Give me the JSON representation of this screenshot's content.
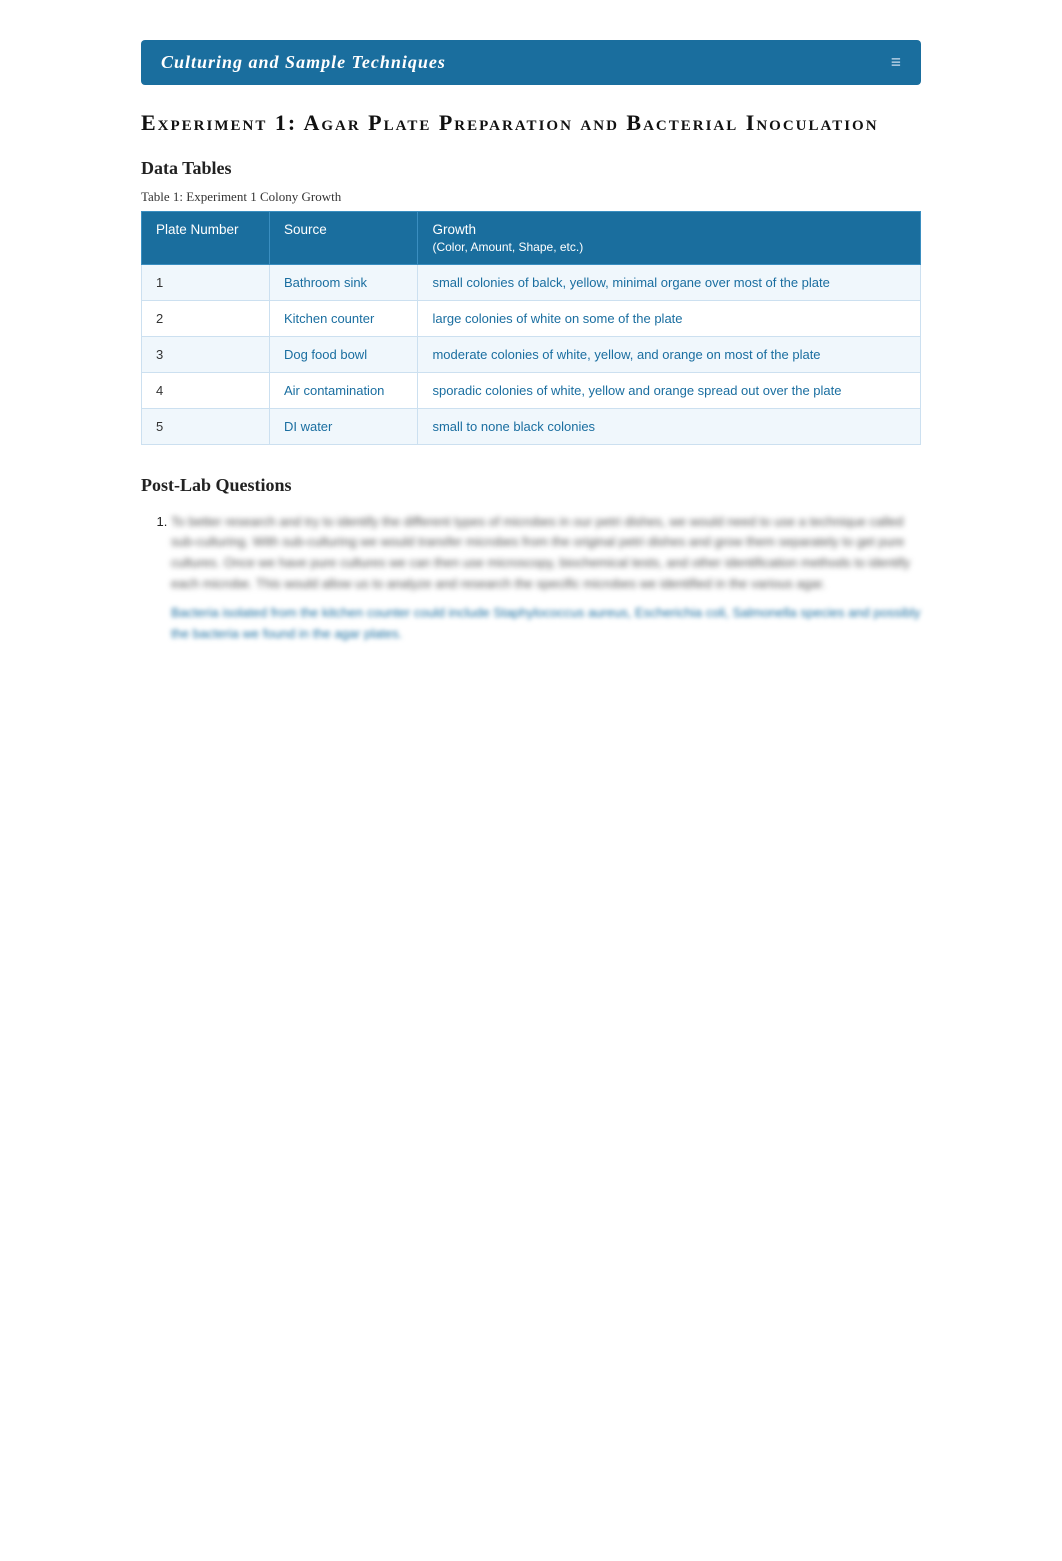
{
  "banner": {
    "title": "Culturing and Sample Techniques",
    "icon": "≡"
  },
  "page_title": "Experiment 1: Agar Plate Preparation and Bacterial Inoculation",
  "data_tables_heading": "Data Tables",
  "table_caption": "Table 1: Experiment 1 Colony Growth",
  "table": {
    "headers": [
      {
        "label": "Plate Number",
        "subtext": ""
      },
      {
        "label": "Source",
        "subtext": ""
      },
      {
        "label": "Growth",
        "subtext": "(Color, Amount, Shape, etc.)"
      }
    ],
    "rows": [
      {
        "plate": "1",
        "source": "Bathroom sink",
        "growth": "small colonies of balck, yellow, minimal organe over most of the plate"
      },
      {
        "plate": "2",
        "source": "Kitchen counter",
        "growth": "large colonies of white on some of the plate"
      },
      {
        "plate": "3",
        "source": "Dog food bowl",
        "growth": "moderate colonies of white, yellow, and orange on most of the plate"
      },
      {
        "plate": "4",
        "source": "Air contamination",
        "growth": "sporadic colonies of white, yellow and orange spread out over the plate"
      },
      {
        "plate": "5",
        "source": "DI water",
        "growth": "small to none black colonies"
      }
    ]
  },
  "post_lab": {
    "heading": "Post-Lab Questions",
    "questions": [
      {
        "blurred_body": "To better research and try to identify the different types of microbes in our petri dishes, we would need to use a technique called sub-culturing. With sub-culturing we would transfer microbes from the original petri dishes and grow them separately to get pure cultures. Once we have pure cultures we can then use microscopy, biochemical tests, and other identification methods to identify each microbe. This would allow us to analyze and research the specific microbes we identified in the various agar.",
        "blurred_answer": "Bacteria isolated from the kitchen counter could include Staphylococcus aureus, Escherichia coli, Salmonella species and possibly the bacteria we found in the agar plates."
      }
    ]
  }
}
